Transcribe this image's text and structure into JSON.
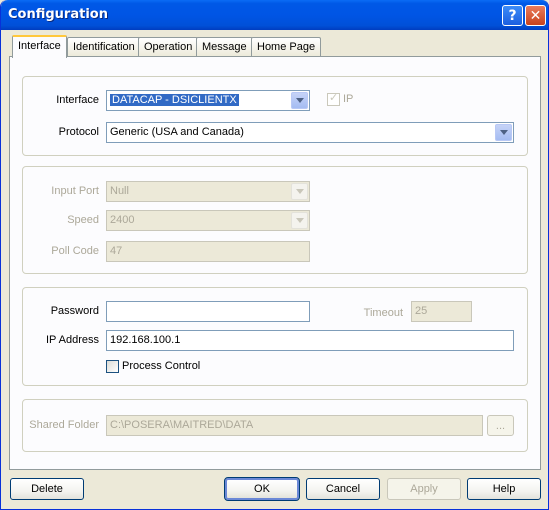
{
  "window": {
    "title": "Configuration"
  },
  "title_buttons": {
    "help": "?",
    "close": "✕"
  },
  "tabs": [
    {
      "label": "Interface",
      "active": true
    },
    {
      "label": "Identification",
      "active": false
    },
    {
      "label": "Operation",
      "active": false
    },
    {
      "label": "Message",
      "active": false
    },
    {
      "label": "Home Page",
      "active": false
    }
  ],
  "interface_group": {
    "interface_label": "Interface",
    "interface_value": "DATACAP - DSICLIENTX",
    "ip_label": "IP",
    "ip_checked": true,
    "protocol_label": "Protocol",
    "protocol_value": "Generic (USA and Canada)"
  },
  "serial_group": {
    "input_port_label": "Input Port",
    "input_port_value": "Null",
    "speed_label": "Speed",
    "speed_value": "2400",
    "poll_code_label": "Poll Code",
    "poll_code_value": "47"
  },
  "network_group": {
    "password_label": "Password",
    "password_value": "",
    "timeout_label": "Timeout",
    "timeout_value": "25",
    "ip_address_label": "IP Address",
    "ip_address_value": "192.168.100.1",
    "process_control_label": "Process Control",
    "process_control_checked": false
  },
  "shared_folder": {
    "label": "Shared Folder",
    "value": "C:\\POSERA\\MAITRED\\DATA",
    "browse_label": "..."
  },
  "buttons": {
    "delete": "Delete",
    "ok": "OK",
    "cancel": "Cancel",
    "apply": "Apply",
    "help": "Help"
  }
}
